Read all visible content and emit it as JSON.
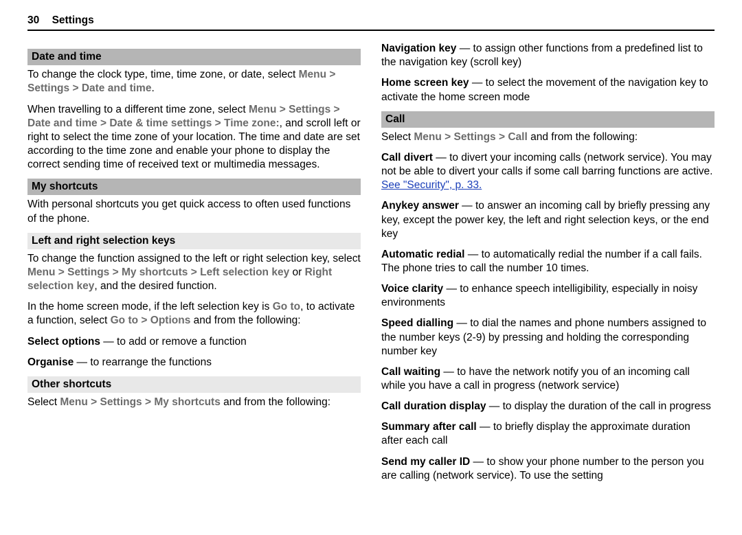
{
  "header": {
    "pageNum": "30",
    "title": "Settings"
  },
  "left": {
    "dateTime": {
      "head": "Date and time",
      "p1a": "To change the clock type, time, time zone, or date, select ",
      "p1b": "Menu",
      "p1c": "Settings",
      "p1d": "Date and time",
      "p2a": "When travelling to a different time zone, select ",
      "p2b": "Menu",
      "p2c": "Settings",
      "p2d": "Date and time",
      "p2e": "Date & time settings",
      "p2f": "Time zone:",
      "p2g": ", and scroll left or right to select the time zone of your location. The time and date are set according to the time zone and enable your phone to display the correct sending time of received text or multimedia messages."
    },
    "shortcuts": {
      "head": "My shortcuts",
      "intro": "With personal shortcuts you get quick access to often used functions of the phone.",
      "subLR": "Left and right selection keys",
      "lr1a": "To change the function assigned to the left or right selection key, select ",
      "menu": "Menu",
      "settings": "Settings",
      "my": "My shortcuts",
      "lr1b": "Left selection key",
      "or": " or ",
      "lr1c": "Right selection key",
      "lr1d": ", and the desired function.",
      "home1a": "In the home screen mode, if the left selection key is ",
      "goto": "Go to",
      "home1b": ", to activate a function, select ",
      "options": "Options",
      "home1c": " and from the following:",
      "sel1a": "Select options",
      "sel1b": "  — to add or remove a function",
      "org1a": "Organise",
      "org1b": "  — to rearrange the functions",
      "subOther": "Other shortcuts",
      "other1a": "Select ",
      "other1b": " and from the following:"
    }
  },
  "right": {
    "nav1a": "Navigation key",
    "nav1b": "  — to assign other functions from a predefined list to the navigation key (scroll key)",
    "home1a": "Home screen key",
    "home1b": "  — to select the movement of the navigation key to activate the home screen mode",
    "callHead": "Call",
    "sel1a": "Select ",
    "menu": "Menu",
    "settings": "Settings",
    "callWord": "Call",
    "sel1b": " and from the following:",
    "cd1a": "Call divert",
    "cd1b": " — to divert your incoming calls (network service). You may not be able to divert your calls if some call barring functions are active. ",
    "link": "See \"Security\", p. 33.",
    "ak1a": "Anykey answer",
    "ak1b": "  — to answer an incoming call by briefly pressing any key, except the power key, the left and right selection keys, or the end key",
    "ar1a": "Automatic redial",
    "ar1b": "  — to automatically redial the number if a call fails. The phone tries to call the number 10 times.",
    "vc1a": "Voice clarity",
    "vc1b": "  — to enhance speech intelligibility, especially in noisy environments",
    "sd1a": "Speed dialling",
    "sd1b": "  — to dial the names and phone numbers assigned to the number keys (2-9) by pressing and holding the corresponding number key",
    "cw1a": "Call waiting",
    "cw1b": "  — to have the network notify you of an incoming call while you have a call in progress (network service)",
    "cdd1a": "Call duration display",
    "cdd1b": "  —  to display the duration of the call in progress",
    "sac1a": "Summary after call",
    "sac1b": "  — to briefly display the approximate duration after each call",
    "sid1a": "Send my caller ID",
    "sid1b": "  — to show your phone number to the person you are calling (network service). To use the setting"
  },
  "gt": " > "
}
